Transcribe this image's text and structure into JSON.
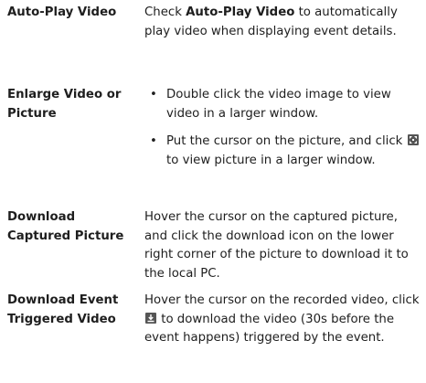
{
  "rows": [
    {
      "term": "Auto-Play Video",
      "desc_prefix": "Check ",
      "desc_bold": "Auto-Play Video",
      "desc_suffix": " to automatically play video when displaying event details."
    },
    {
      "term": "Enlarge Video or Picture",
      "bullets": [
        {
          "text": "Double click the video image to view video in a larger window."
        },
        {
          "text_before": "Put the cursor on the picture, and click ",
          "icon": "enlarge-icon",
          "text_after": " to view picture in a larger window."
        }
      ]
    },
    {
      "term": "Download Captured Picture",
      "desc": "Hover the cursor on the captured picture, and click the download icon on the lower right corner of the picture to download it to the local PC."
    },
    {
      "term": "Download Event Triggered Video",
      "desc_before": "Hover the cursor on the recorded video, click ",
      "icon": "download-icon",
      "desc_after": " to download the video (30s before the event happens) triggered by the event."
    }
  ],
  "colors": {
    "text": "#1e1e1e",
    "icon_bg": "#555555"
  }
}
